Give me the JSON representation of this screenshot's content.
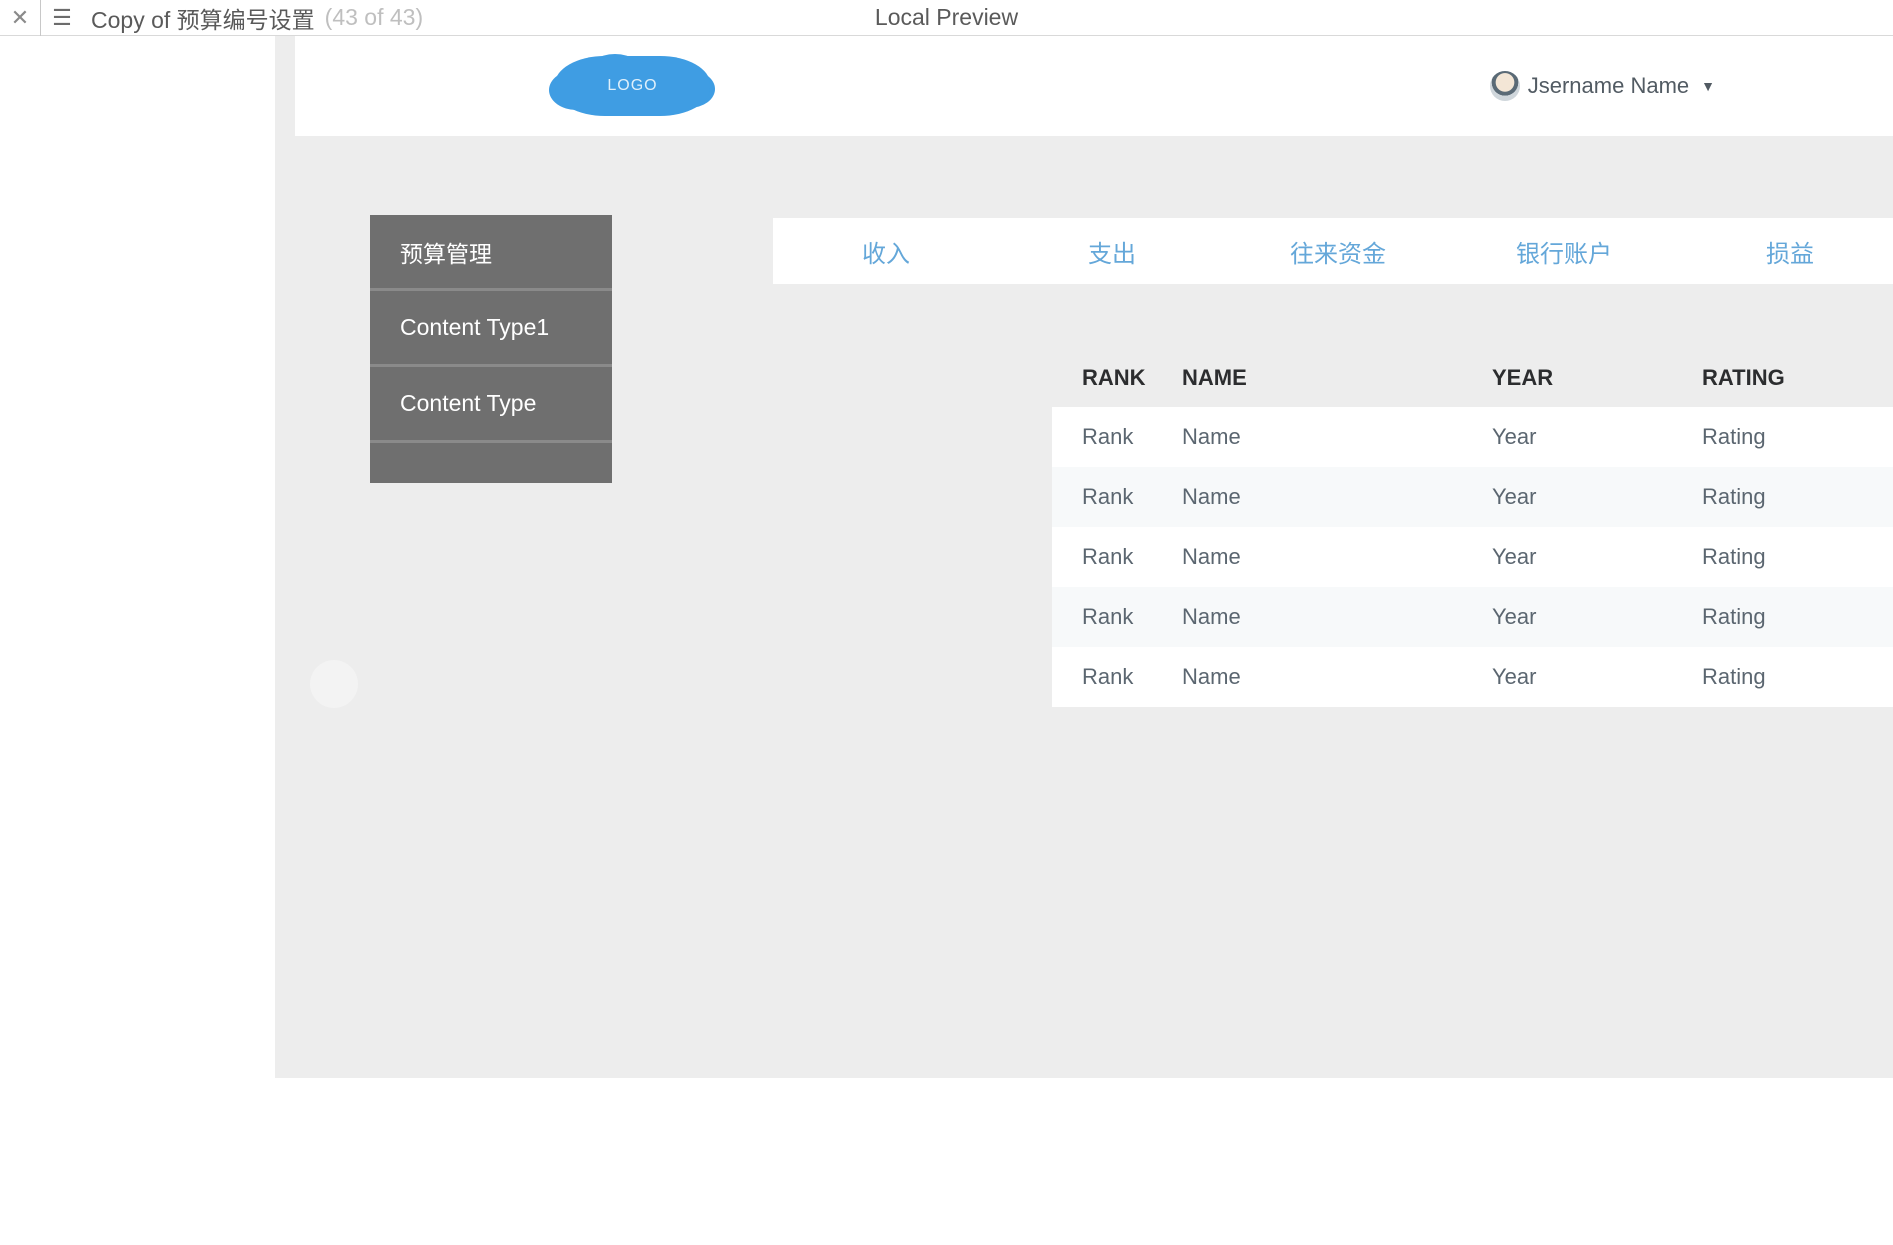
{
  "editor": {
    "title": "Copy of 预算编号设置",
    "counter": "(43 of 43)",
    "center_label": "Local Preview"
  },
  "header": {
    "logo_text": "LOGO",
    "user_name": "Jsername Name"
  },
  "sidebar": {
    "items": [
      {
        "label": "预算管理"
      },
      {
        "label": "Content Type1"
      },
      {
        "label": "Content Type"
      },
      {
        "label": ""
      }
    ]
  },
  "tabs": [
    {
      "label": "收入"
    },
    {
      "label": "支出"
    },
    {
      "label": "往来资金"
    },
    {
      "label": "银行账户"
    },
    {
      "label": "损益"
    }
  ],
  "table": {
    "headers": {
      "rank": "RANK",
      "name": "NAME",
      "year": "YEAR",
      "rating": "RATING"
    },
    "rows": [
      {
        "rank": "Rank",
        "name": "Name",
        "year": "Year",
        "rating": "Rating"
      },
      {
        "rank": "Rank",
        "name": "Name",
        "year": "Year",
        "rating": "Rating"
      },
      {
        "rank": "Rank",
        "name": "Name",
        "year": "Year",
        "rating": "Rating"
      },
      {
        "rank": "Rank",
        "name": "Name",
        "year": "Year",
        "rating": "Rating"
      },
      {
        "rank": "Rank",
        "name": "Name",
        "year": "Year",
        "rating": "Rating"
      }
    ]
  }
}
